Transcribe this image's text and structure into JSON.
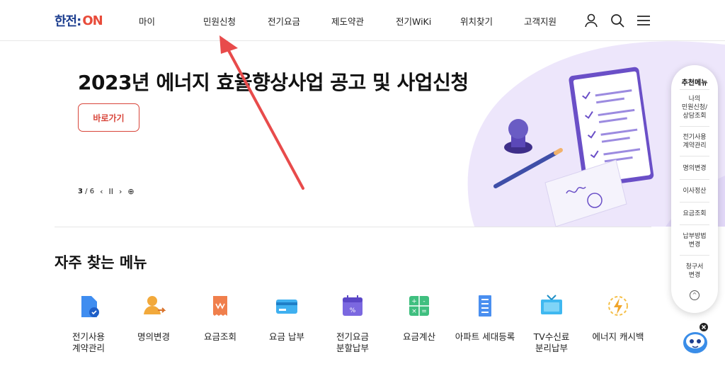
{
  "brand": {
    "ko": "한전:",
    "on": "ON"
  },
  "nav": [
    "마이",
    "민원신청",
    "전기요금",
    "제도약관",
    "전기WiKi",
    "위치찾기",
    "고객지원"
  ],
  "header_icons": [
    "user-icon",
    "search-icon",
    "menu-icon"
  ],
  "hero": {
    "title": "2023년 에너지 효율향상사업 공고 및 사업신청",
    "button": "바로가기",
    "page_current": "3",
    "page_total": "/ 6",
    "prev": "‹",
    "pause": "II",
    "next": "›",
    "more": "⊕"
  },
  "section_title": "자주 찾는 메뉴",
  "menu": [
    {
      "label1": "전기사용",
      "label2": "계약관리",
      "icon": "contract-icon"
    },
    {
      "label1": "명의변경",
      "label2": "",
      "icon": "person-change-icon"
    },
    {
      "label1": "요금조회",
      "label2": "",
      "icon": "bill-icon"
    },
    {
      "label1": "요금 납부",
      "label2": "",
      "icon": "card-icon"
    },
    {
      "label1": "전기요금",
      "label2": "분할납부",
      "icon": "calendar-icon"
    },
    {
      "label1": "요금계산",
      "label2": "",
      "icon": "calculator-icon"
    },
    {
      "label1": "아파트 세대등록",
      "label2": "",
      "icon": "apartment-icon"
    },
    {
      "label1": "TV수신료",
      "label2": "분리납부",
      "icon": "tv-icon"
    },
    {
      "label1": "에너지 캐시백",
      "label2": "",
      "icon": "energy-icon"
    }
  ],
  "rail": {
    "title": "추천메뉴",
    "items": [
      [
        "나의",
        "민원신청/",
        "상담조회"
      ],
      [
        "전기사용",
        "계약관리"
      ],
      [
        "명의변경"
      ],
      [
        "이사정산"
      ],
      [
        "요금조회"
      ],
      [
        "납부방법",
        "변경"
      ],
      [
        "청구서",
        "변경"
      ]
    ],
    "up": "^"
  },
  "colors": {
    "brand_blue": "#1d3e8f",
    "brand_red": "#e84b3a",
    "accent_red": "#d8453a",
    "hero_purple": "#ede6fb"
  }
}
